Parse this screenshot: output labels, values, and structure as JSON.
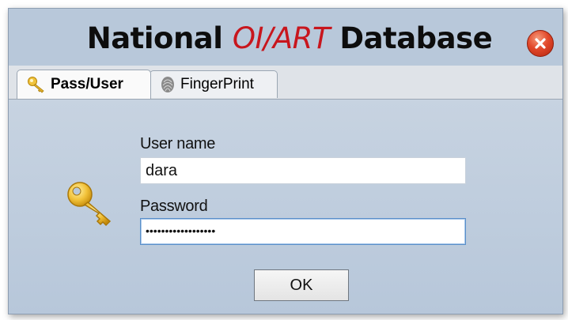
{
  "window": {
    "title_prefix": "National ",
    "title_accent": "OI/ART",
    "title_suffix": " Database",
    "accent_color": "#c8161d"
  },
  "tabs": [
    {
      "label": "Pass/User",
      "icon": "key-icon",
      "selected": true
    },
    {
      "label": "FingerPrint",
      "icon": "fingerprint-icon",
      "selected": false
    }
  ],
  "form": {
    "username_label": "User name",
    "username_value": "dara",
    "password_label": "Password",
    "password_masked": "••••••••••••••••••",
    "ok_label": "OK"
  },
  "icons": {
    "close": "close-icon",
    "key": "key-icon"
  }
}
